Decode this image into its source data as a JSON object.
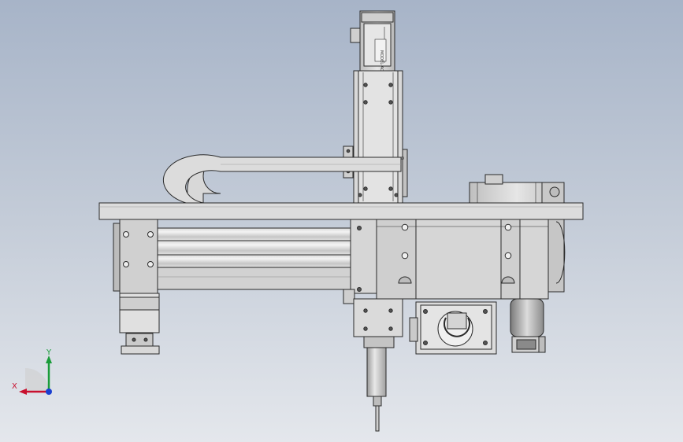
{
  "axis_triad": {
    "x_label": "X",
    "y_label": "Y",
    "x_color": "#c8102e",
    "y_color": "#1a9c3a",
    "z_color": "#1a3fd0"
  },
  "motor_label": "MODEL·AC-SERVO",
  "background": {
    "top": "#a7b4c8",
    "bottom": "#e4e7ec"
  }
}
